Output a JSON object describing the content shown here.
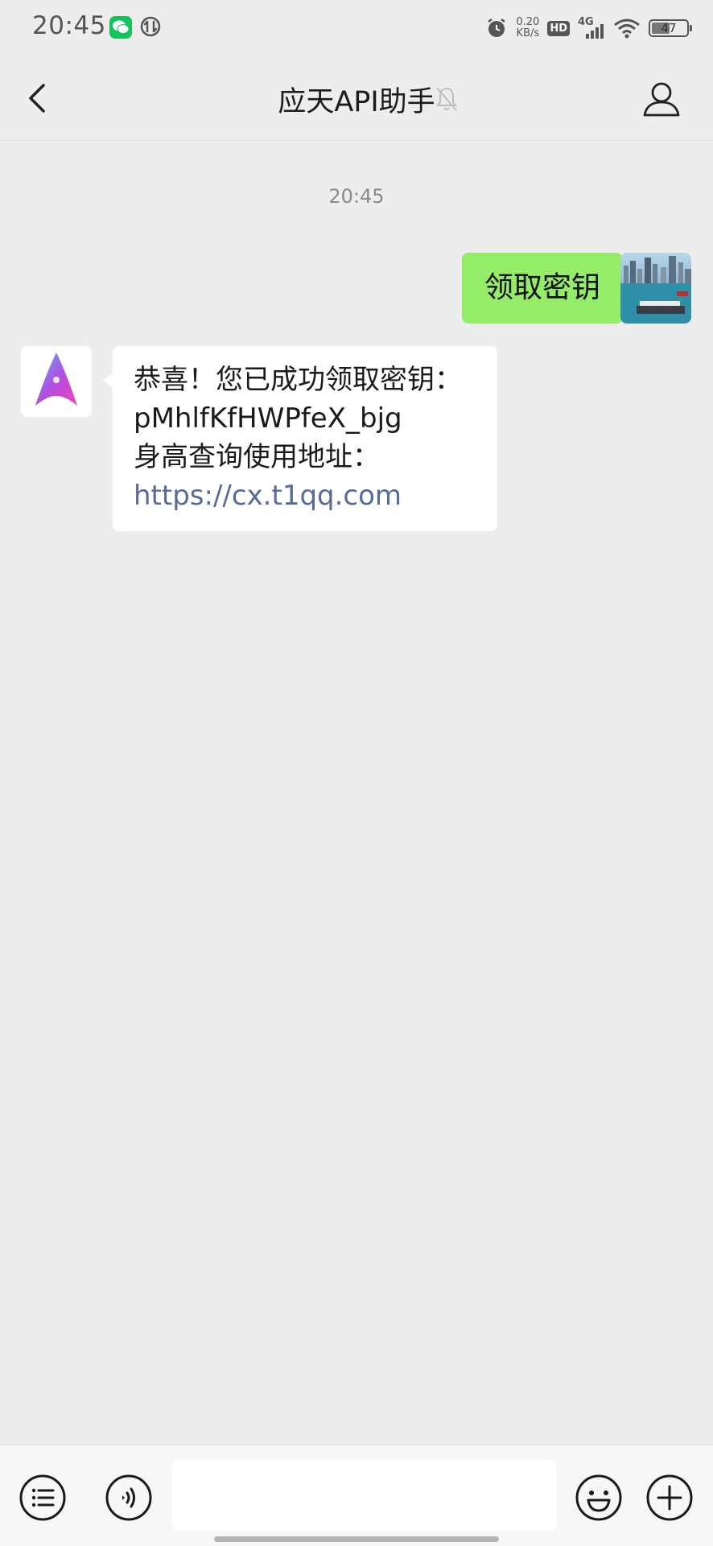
{
  "status_bar": {
    "time": "20:45",
    "network_speed_value": "0.20",
    "network_speed_unit": "KB/s",
    "hd_label": "HD",
    "signal_label": "4G",
    "battery_level": "47"
  },
  "nav": {
    "title": "应天API助手"
  },
  "chat": {
    "timestamp": "20:45",
    "outgoing": {
      "text": "领取密钥"
    },
    "incoming": {
      "line1": "恭喜！您已成功领取密钥：",
      "line2": "pMhlfKfHWPfeX_bjg",
      "line3": "身高查询使用地址：",
      "link": "https://cx.t1qq.com"
    }
  },
  "colors": {
    "outgoing_bubble": "#95ec69",
    "link": "#576b95",
    "background": "#ededed"
  },
  "icons": [
    "back-icon",
    "mute-bell-icon",
    "profile-icon",
    "menu-list-icon",
    "voice-icon",
    "emoji-icon",
    "plus-icon"
  ]
}
